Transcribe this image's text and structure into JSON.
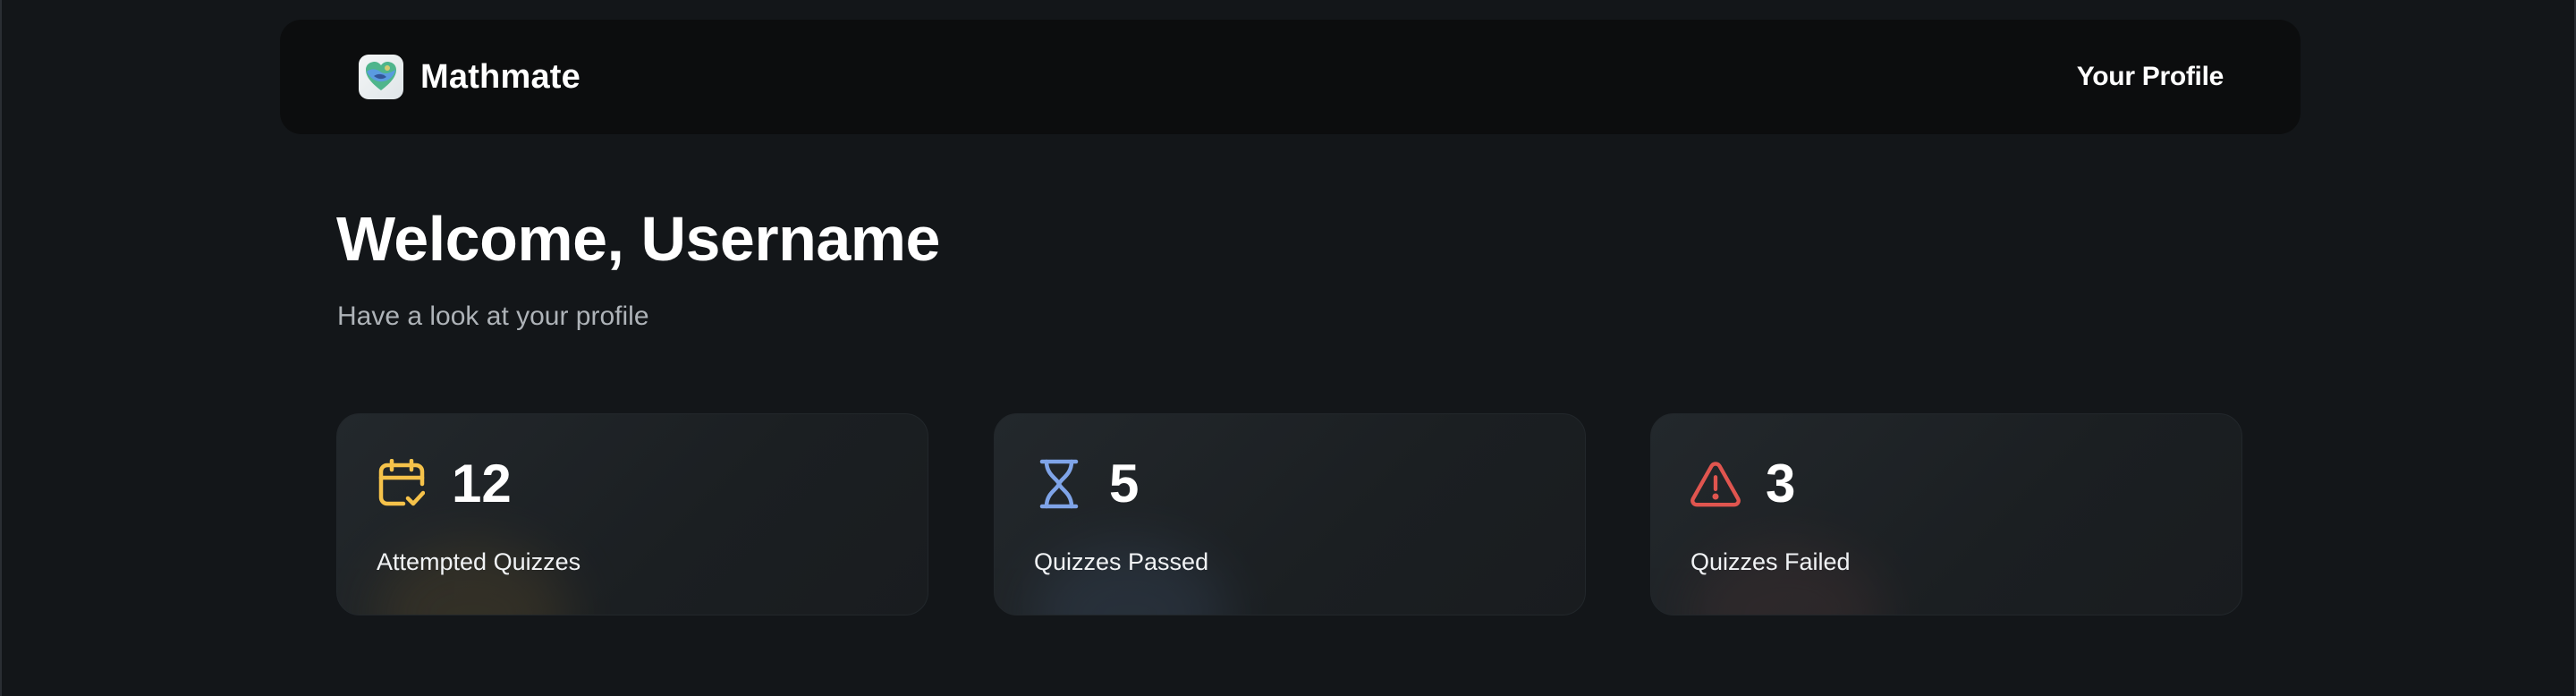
{
  "navbar": {
    "brand_name": "Mathmate",
    "profile_link": "Your Profile"
  },
  "welcome": {
    "title": "Welcome, Username",
    "subtitle": "Have a look at your profile"
  },
  "stats": [
    {
      "value": "12",
      "label": "Attempted Quizzes",
      "icon": "calendar-check-icon",
      "color": "#f5c24a"
    },
    {
      "value": "5",
      "label": "Quizzes Passed",
      "icon": "hourglass-icon",
      "color": "#7fa4e8"
    },
    {
      "value": "3",
      "label": "Quizzes Failed",
      "icon": "warning-triangle-icon",
      "color": "#e0554f"
    }
  ],
  "colors": {
    "background": "#131619",
    "navbar": "#0c0d0e",
    "card": "#1e2226",
    "subtitle": "#aeb3b8"
  }
}
